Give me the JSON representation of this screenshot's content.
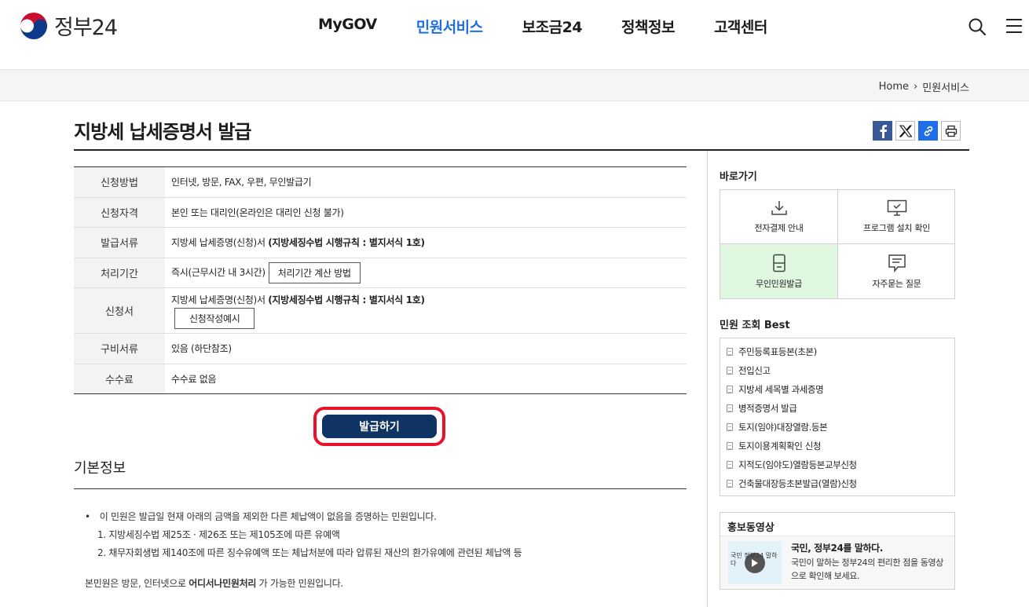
{
  "header": {
    "logo_text": "정부24",
    "nav": [
      "MyGOV",
      "민원서비스",
      "보조금24",
      "정책정보",
      "고객센터"
    ],
    "active_nav": "민원서비스"
  },
  "breadcrumb": {
    "home": "Home",
    "separator": "›",
    "current": "민원서비스"
  },
  "page_title": "지방세 납세증명서 발급",
  "info_table": [
    {
      "label": "신청방법",
      "value": "인터넷, 방문, FAX, 우편, 무인발급기"
    },
    {
      "label": "신청자격",
      "value": "본인 또는 대리인(온라인은 대리인 신청 불가)"
    },
    {
      "label": "발급서류",
      "value": "지방세 납세증명(신청)서 ",
      "bold": "(지방세징수법 시행규칙 : 별지서식 1호)"
    },
    {
      "label": "처리기간",
      "value": "즉시(근무시간 내 3시간)",
      "button": "처리기간 계산 방법"
    },
    {
      "label": "신청서",
      "value": "지방세 납세증명(신청)서 ",
      "bold": "(지방세징수법 시행규칙 : 별지서식 1호)",
      "button": "신청작성예시"
    },
    {
      "label": "구비서류",
      "value": "있음 (하단참조)"
    },
    {
      "label": "수수료",
      "value": "수수료 없음"
    }
  ],
  "issue_button": "발급하기",
  "basic_info": {
    "title": "기본정보",
    "main": "이 민원은 발급일 현재 아래의 금액을 제외한 다른 체납액이 없음을 증명하는 민원입니다.",
    "items": [
      "1. 지방세징수법 제25조 · 제26조 또는 제105조에 따른 유예액",
      "2. 채무자회생법 제140조에 따른 징수유예액 또는 체납처분에 따라 압류된 재산의 환가유예에 관련된 체납액 등"
    ],
    "foot_pre": "본민원은 방문, 인터넷으로 ",
    "foot_bold": "어디서나민원처리",
    "foot_post": " 가 가능한 민원입니다."
  },
  "sidebar": {
    "quick_title": "바로가기",
    "quick": [
      {
        "label": "전자결제 안내",
        "icon": "download-icon"
      },
      {
        "label": "프로그램 설치 확인",
        "icon": "monitor-check-icon"
      },
      {
        "label": "무인민원발급",
        "icon": "kiosk-icon"
      },
      {
        "label": "자주묻는 질문",
        "icon": "chat-icon"
      }
    ],
    "best_title": "민원 조회 Best",
    "best": [
      "주민등록표등본(초본)",
      "전입신고",
      "지방세 세목별 과세증명",
      "병적증명서 발급",
      "토지(임야)대장열람.등본",
      "토지이용계획확인 신청",
      "지적도(임야도)열람등본교부신청",
      "건축물대장등초본발급(열람)신청"
    ],
    "promo_title": "홍보동영상",
    "promo_video_title": "국민, 정부24를 말하다.",
    "promo_desc": "국민이 말하는 정부24의 편리한 점을 동영상으로 확인해 보세요.",
    "promo_thumb_text": "국민 정부24 말하다"
  },
  "colors": {
    "accent": "#1d6ee8",
    "issue_button": "#0f3463",
    "highlight_border": "#e8132a",
    "quick_highlight": "#dff8df"
  }
}
